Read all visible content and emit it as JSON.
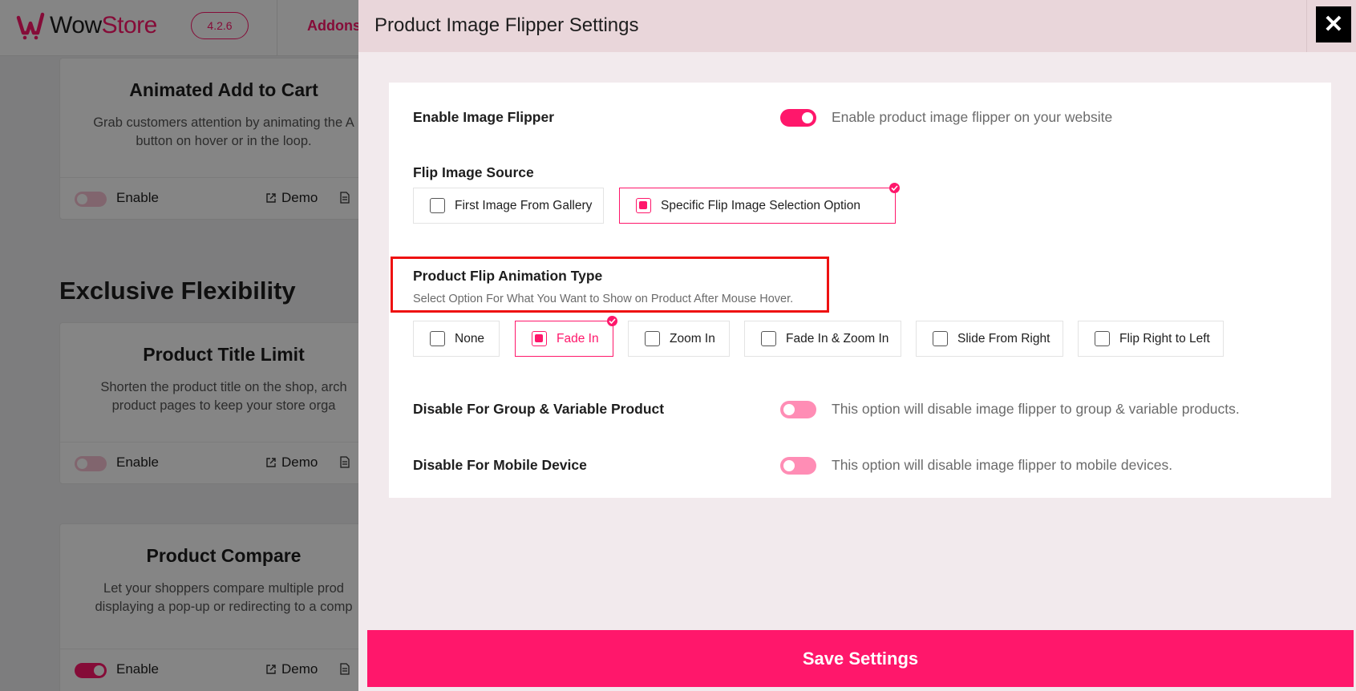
{
  "app": {
    "logo_prefix": "Wow",
    "logo_suffix": "Store",
    "version": "4.2.6",
    "nav_link": "Addons"
  },
  "colors": {
    "accent": "#ff176b",
    "accent_light": "#ff8db5",
    "drawer_bg": "#f2eaed",
    "header_bg": "#e9d6da",
    "highlight": "#ee1111"
  },
  "background_cards": [
    {
      "title": "Animated Add to Cart",
      "line1": "Grab customers attention by animating the A",
      "line2": "button on hover or in the loop.",
      "enable_label": "Enable",
      "demo_label": "Demo",
      "enabled": false
    },
    {
      "title": "Product Title Limit",
      "line1": "Shorten the product title on the shop, arch",
      "line2": "product pages to keep your store orga",
      "enable_label": "Enable",
      "demo_label": "Demo",
      "enabled": false
    },
    {
      "title": "Product Compare",
      "line1": "Let your shoppers compare multiple prod",
      "line2": "displaying a pop-up or redirecting to a comp",
      "enable_label": "Enable",
      "demo_label": "Demo",
      "enabled": true
    }
  ],
  "section_title": "Exclusive Flexibility",
  "drawer": {
    "title": "Product Image Flipper Settings",
    "close_icon": "close-icon",
    "save_label": "Save Settings",
    "enable_flipper": {
      "label": "Enable Image Flipper",
      "description": "Enable product image flipper on your website",
      "on": true
    },
    "flip_source": {
      "label": "Flip Image Source",
      "options": [
        "First Image From Gallery",
        "Specific Flip Image Selection Option"
      ],
      "selected": "Specific Flip Image Selection Option"
    },
    "animation_type": {
      "label": "Product Flip Animation Type",
      "description": "Select Option For What You Want to Show on Product After Mouse Hover.",
      "options": [
        "None",
        "Fade In",
        "Zoom In",
        "Fade In & Zoom In",
        "Slide From Right",
        "Flip Right to Left"
      ],
      "selected": "Fade In"
    },
    "disable_group": {
      "label": "Disable For Group & Variable Product",
      "description": "This option will disable image flipper to group & variable products.",
      "on": false
    },
    "disable_mobile": {
      "label": "Disable For Mobile Device",
      "description": "This option will disable image flipper to mobile devices.",
      "on": false
    }
  }
}
